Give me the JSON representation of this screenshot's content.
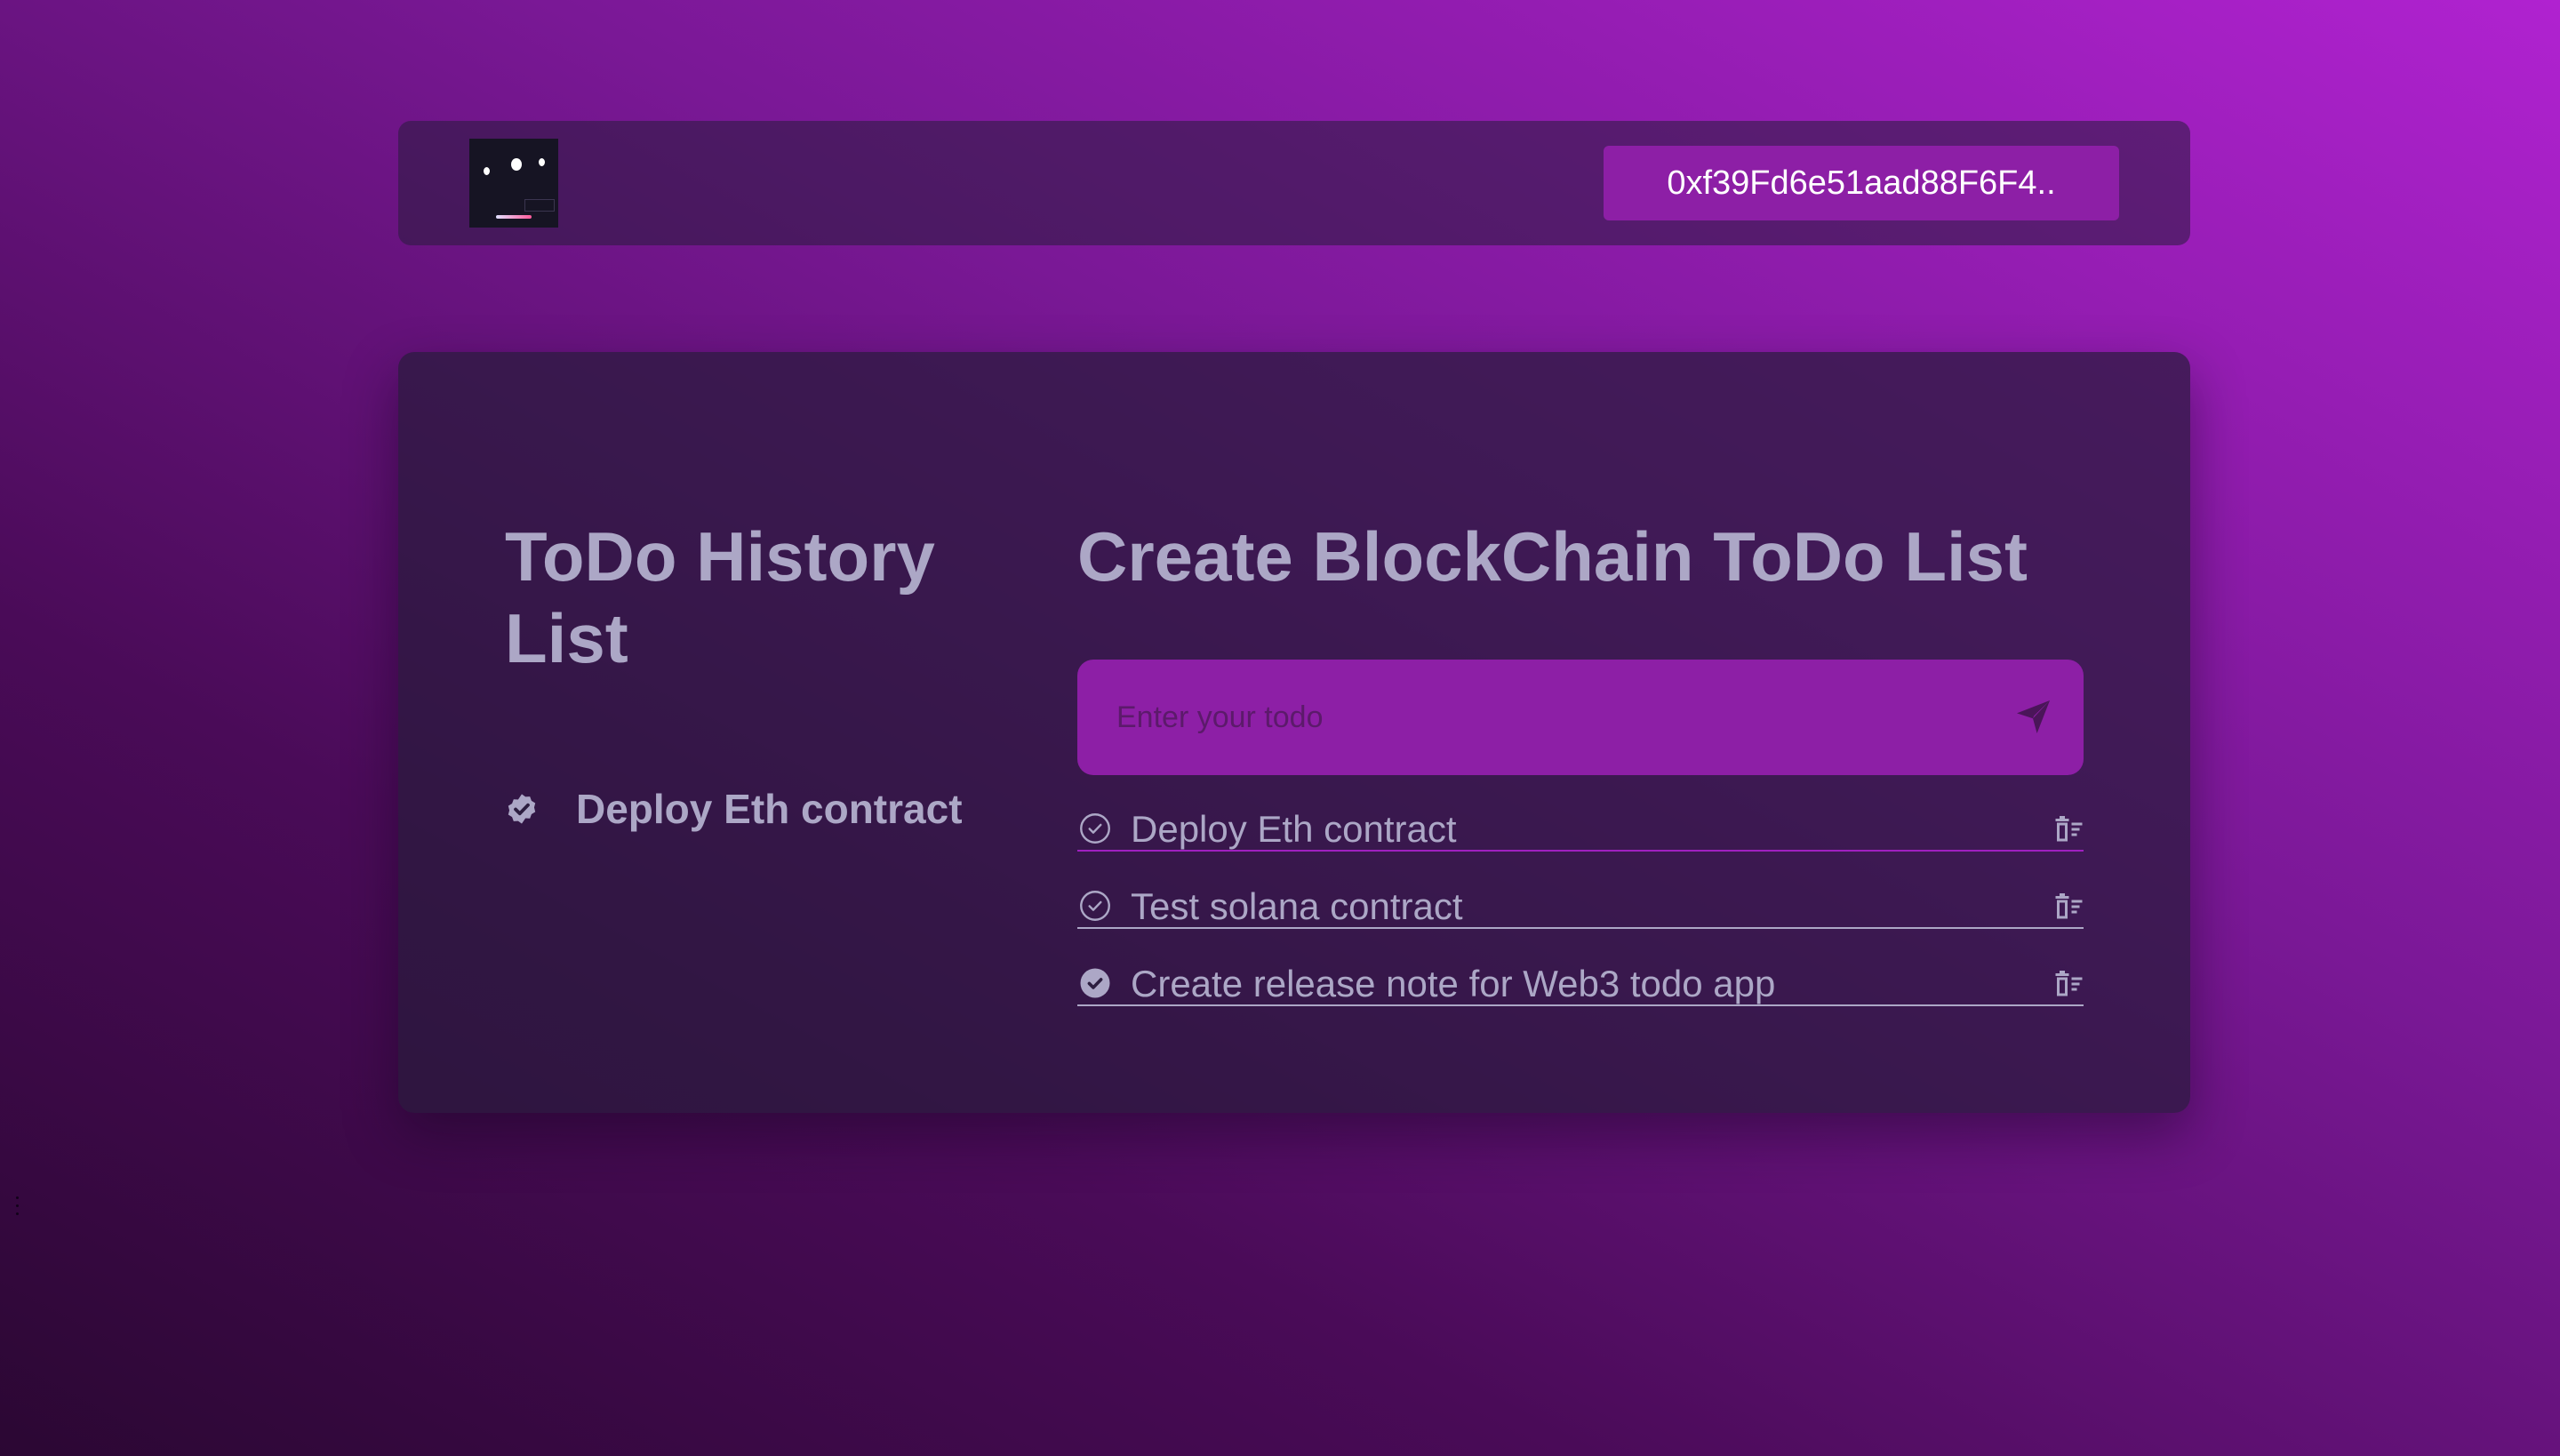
{
  "colors": {
    "accent": "#8d1fa6",
    "text_muted": "#aca7c6",
    "panel": "#2d1e40",
    "underline_active": "#a020c0",
    "underline_default": "#aca7c6"
  },
  "navbar": {
    "logo_icon": "avatar-logo",
    "wallet_address": "0xf39Fd6e51aad88F6F4.."
  },
  "history": {
    "title": "ToDo History List",
    "items": [
      {
        "label": "Deploy Eth contract",
        "icon": "verified-badge-icon"
      }
    ]
  },
  "create": {
    "title": "Create BlockChain ToDo List",
    "input_placeholder": "Enter your todo",
    "input_value": "",
    "submit_icon": "send-icon"
  },
  "todos": [
    {
      "text": "Deploy Eth contract",
      "completed": false,
      "check_icon": "circle-check-outline-icon",
      "delete_icon": "delete-icon"
    },
    {
      "text": "Test solana contract",
      "completed": false,
      "check_icon": "circle-check-outline-icon",
      "delete_icon": "delete-icon"
    },
    {
      "text": "Create release note for Web3 todo app",
      "completed": true,
      "check_icon": "circle-check-filled-icon",
      "delete_icon": "delete-icon"
    }
  ]
}
